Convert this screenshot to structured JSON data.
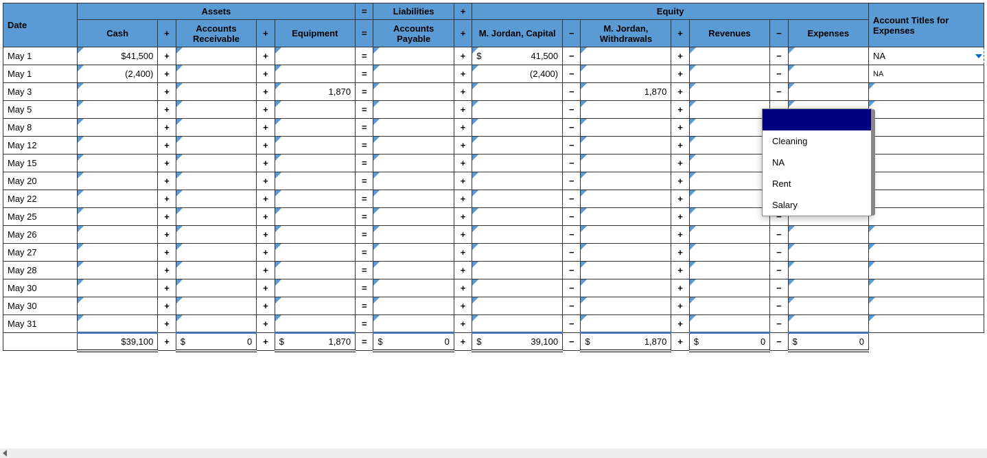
{
  "headers": {
    "assets": "Assets",
    "liabilities": "Liabilities",
    "equity": "Equity",
    "date": "Date",
    "cash": "Cash",
    "ar": "Accounts Receivable",
    "equipment": "Equipment",
    "ap": "Accounts Payable",
    "capital": "M. Jordan, Capital",
    "withdrawals": "M. Jordan, Withdrawals",
    "revenues": "Revenues",
    "expenses": "Expenses",
    "account_titles": "Account Titles for Expenses",
    "eq": "=",
    "plus": "+",
    "minus": "−"
  },
  "rows": [
    {
      "date": "May 1",
      "cash": "$41,500",
      "ar": "",
      "equipment": "",
      "ap": "",
      "capital_prefix": "$",
      "capital": "41,500",
      "withdrawals": "",
      "revenues": "",
      "expenses": "",
      "title": "NA",
      "is_dropdown": true
    },
    {
      "date": "May 1",
      "cash": "(2,400)",
      "ar": "",
      "equipment": "",
      "ap": "",
      "capital_prefix": "",
      "capital": "(2,400)",
      "withdrawals": "",
      "revenues": "",
      "expenses": "",
      "title": "NA",
      "title_clipped": true
    },
    {
      "date": "May 3",
      "cash": "",
      "ar": "",
      "equipment": "1,870",
      "ap": "",
      "capital_prefix": "",
      "capital": "",
      "withdrawals": "1,870",
      "revenues": "",
      "expenses": "",
      "title": ""
    },
    {
      "date": "May 5",
      "cash": "",
      "ar": "",
      "equipment": "",
      "ap": "",
      "capital_prefix": "",
      "capital": "",
      "withdrawals": "",
      "revenues": "",
      "expenses": "",
      "title": ""
    },
    {
      "date": "May 8",
      "cash": "",
      "ar": "",
      "equipment": "",
      "ap": "",
      "capital_prefix": "",
      "capital": "",
      "withdrawals": "",
      "revenues": "",
      "expenses": "",
      "title": ""
    },
    {
      "date": "May 12",
      "cash": "",
      "ar": "",
      "equipment": "",
      "ap": "",
      "capital_prefix": "",
      "capital": "",
      "withdrawals": "",
      "revenues": "",
      "expenses": "",
      "title": ""
    },
    {
      "date": "May 15",
      "cash": "",
      "ar": "",
      "equipment": "",
      "ap": "",
      "capital_prefix": "",
      "capital": "",
      "withdrawals": "",
      "revenues": "",
      "expenses": "",
      "title": ""
    },
    {
      "date": "May 20",
      "cash": "",
      "ar": "",
      "equipment": "",
      "ap": "",
      "capital_prefix": "",
      "capital": "",
      "withdrawals": "",
      "revenues": "",
      "expenses": "",
      "title": ""
    },
    {
      "date": "May 22",
      "cash": "",
      "ar": "",
      "equipment": "",
      "ap": "",
      "capital_prefix": "",
      "capital": "",
      "withdrawals": "",
      "revenues": "",
      "expenses": "",
      "title": ""
    },
    {
      "date": "May 25",
      "cash": "",
      "ar": "",
      "equipment": "",
      "ap": "",
      "capital_prefix": "",
      "capital": "",
      "withdrawals": "",
      "revenues": "",
      "expenses": "",
      "title": ""
    },
    {
      "date": "May 26",
      "cash": "",
      "ar": "",
      "equipment": "",
      "ap": "",
      "capital_prefix": "",
      "capital": "",
      "withdrawals": "",
      "revenues": "",
      "expenses": "",
      "title": ""
    },
    {
      "date": "May 27",
      "cash": "",
      "ar": "",
      "equipment": "",
      "ap": "",
      "capital_prefix": "",
      "capital": "",
      "withdrawals": "",
      "revenues": "",
      "expenses": "",
      "title": ""
    },
    {
      "date": "May 28",
      "cash": "",
      "ar": "",
      "equipment": "",
      "ap": "",
      "capital_prefix": "",
      "capital": "",
      "withdrawals": "",
      "revenues": "",
      "expenses": "",
      "title": ""
    },
    {
      "date": "May 30",
      "cash": "",
      "ar": "",
      "equipment": "",
      "ap": "",
      "capital_prefix": "",
      "capital": "",
      "withdrawals": "",
      "revenues": "",
      "expenses": "",
      "title": ""
    },
    {
      "date": "May 30",
      "cash": "",
      "ar": "",
      "equipment": "",
      "ap": "",
      "capital_prefix": "",
      "capital": "",
      "withdrawals": "",
      "revenues": "",
      "expenses": "",
      "title": ""
    },
    {
      "date": "May 31",
      "cash": "",
      "ar": "",
      "equipment": "",
      "ap": "",
      "capital_prefix": "",
      "capital": "",
      "withdrawals": "",
      "revenues": "",
      "expenses": "",
      "title": ""
    }
  ],
  "totals": {
    "cash": "$39,100",
    "ar_prefix": "$",
    "ar": "0",
    "equipment_prefix": "$",
    "equipment": "1,870",
    "ap_prefix": "$",
    "ap": "0",
    "capital_prefix": "$",
    "capital": "39,100",
    "withdrawals_prefix": "$",
    "withdrawals": "1,870",
    "revenues_prefix": "$",
    "revenues": "0",
    "expenses_prefix": "$",
    "expenses": "0"
  },
  "dropdown": {
    "options": [
      "",
      "Cleaning",
      "NA",
      "Rent",
      "Salary"
    ]
  }
}
